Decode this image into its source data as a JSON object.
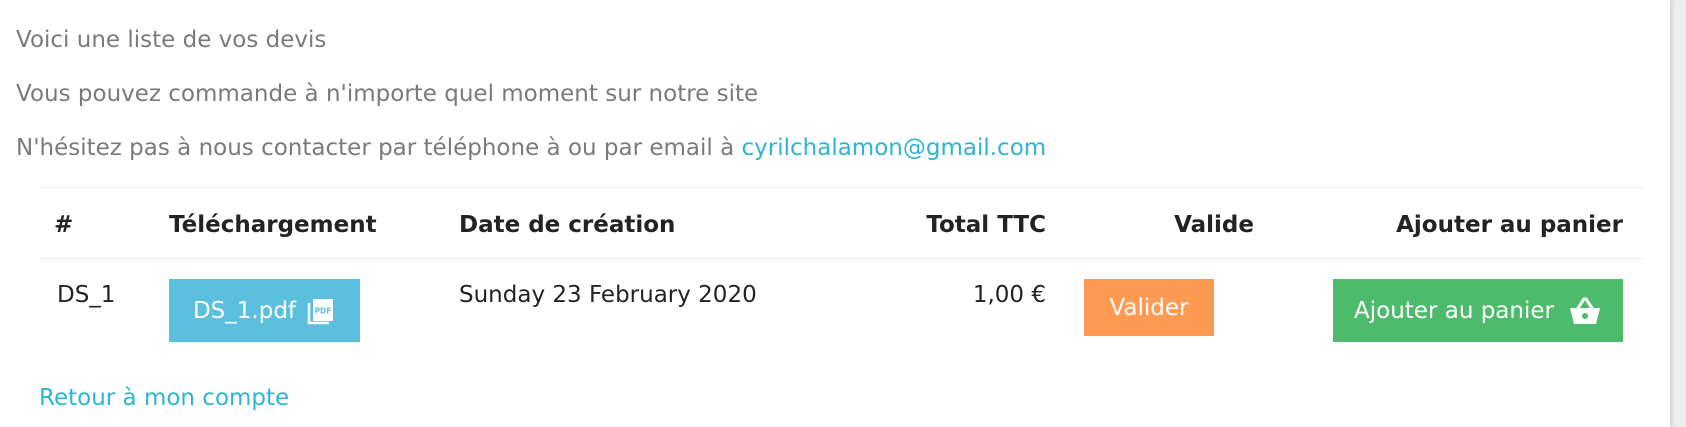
{
  "intro": {
    "line1": "Voici une liste de vos devis",
    "line2": "Vous pouvez commande à n'importe quel moment sur notre site",
    "line3_prefix": "N'hésitez pas à nous contacter par téléphone à ou par email à ",
    "email": "cyrilchalamon@gmail.com"
  },
  "table": {
    "headers": {
      "number": "#",
      "download": "Téléchargement",
      "created": "Date de création",
      "total": "Total TTC",
      "valid": "Valide",
      "add_to_cart": "Ajouter au panier"
    },
    "rows": [
      {
        "number": "DS_1",
        "download_label": "DS_1.pdf",
        "created": "Sunday 23 February 2020",
        "total": "1,00 €",
        "validate_label": "Valider",
        "cart_label": "Ajouter au panier"
      }
    ]
  },
  "back_link": "Retour à mon compte",
  "icons": {
    "pdf": "pdf-file-icon",
    "cart": "shopping-basket-icon"
  },
  "colors": {
    "link": "#2fb5d2",
    "pdf_button": "#5bc0de",
    "validate_button": "#ff9a52",
    "cart_button": "#4cbb6c"
  }
}
